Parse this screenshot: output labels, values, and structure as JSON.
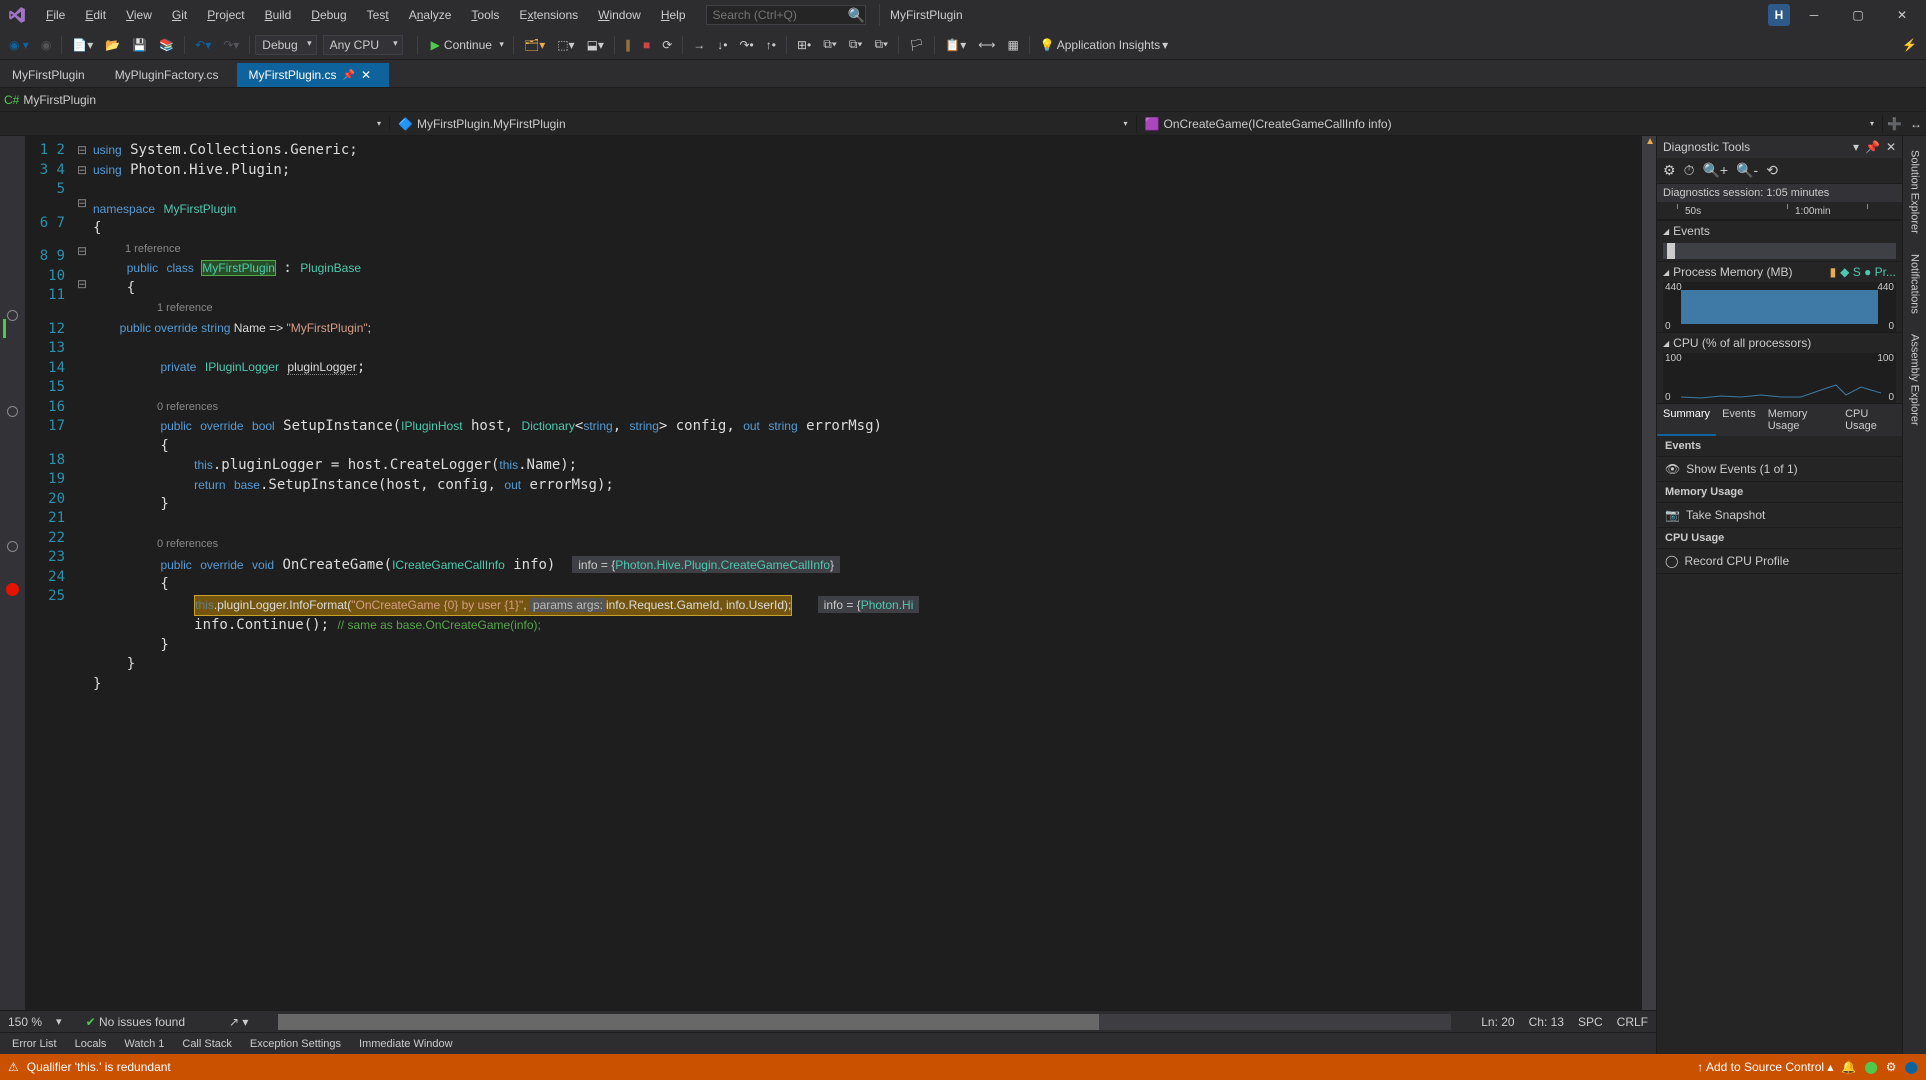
{
  "menubar": {
    "items": [
      "File",
      "Edit",
      "View",
      "Git",
      "Project",
      "Build",
      "Debug",
      "Test",
      "Analyze",
      "Tools",
      "Extensions",
      "Window",
      "Help"
    ],
    "search_placeholder": "Search (Ctrl+Q)",
    "app_title": "MyFirstPlugin",
    "user_initial": "H"
  },
  "toolbar": {
    "config": "Debug",
    "platform": "Any CPU",
    "continue": "Continue",
    "insights": "Application Insights"
  },
  "tabs": [
    {
      "label": "MyFirstPlugin",
      "active": false
    },
    {
      "label": "MyPluginFactory.cs",
      "active": false
    },
    {
      "label": "MyFirstPlugin.cs",
      "active": true,
      "pinned": true
    }
  ],
  "nav": {
    "project": "MyFirstPlugin"
  },
  "context": {
    "class": "MyFirstPlugin.MyFirstPlugin",
    "member": "OnCreateGame(ICreateGameCallInfo info)"
  },
  "codelens": {
    "ref1": "1 reference",
    "ref1b": "1 reference",
    "ref0a": "0 references",
    "ref0b": "0 references"
  },
  "datatip1": {
    "prefix": "info = {",
    "type": "Photon.Hive.Plugin.CreateGameCallInfo",
    "suffix": "}"
  },
  "datatip2": {
    "prefix": "info = {",
    "type": "Photon.Hi"
  },
  "param_hint": "params args:",
  "editor_status": {
    "zoom": "150 %",
    "issues": "No issues found",
    "line": "Ln: 20",
    "col": "Ch: 13",
    "ins": "SPC",
    "eol": "CRLF"
  },
  "bottom_tabs": [
    "Error List",
    "Locals",
    "Watch 1",
    "Call Stack",
    "Exception Settings",
    "Immediate Window"
  ],
  "status": {
    "msg": "Qualifier 'this.' is redundant",
    "source": "Add to Source Control"
  },
  "diag": {
    "title": "Diagnostic Tools",
    "session": "Diagnostics session: 1:05 minutes",
    "timeline": {
      "t1": "50s",
      "t2": "1:00min"
    },
    "events": "Events",
    "mem": {
      "title": "Process Memory (MB)",
      "max": "440",
      "min": "0",
      "legend": "◆ S  ● Pr..."
    },
    "cpu": {
      "title": "CPU (% of all processors)",
      "max": "100",
      "min": "0"
    },
    "tabs": [
      "Summary",
      "Events",
      "Memory Usage",
      "CPU Usage"
    ],
    "sections": {
      "events": {
        "title": "Events",
        "action": "Show Events (1 of 1)"
      },
      "memory": {
        "title": "Memory Usage",
        "action": "Take Snapshot"
      },
      "cpu": {
        "title": "CPU Usage",
        "action": "Record CPU Profile"
      }
    }
  },
  "side_tabs": [
    "Solution Explorer",
    "Notifications",
    "Assembly Explorer"
  ],
  "chart_data": {
    "type": "line",
    "charts": [
      {
        "name": "Process Memory",
        "unit": "MB",
        "ylim": [
          0,
          440
        ],
        "x_range_seconds": [
          45,
          70
        ],
        "series": [
          {
            "name": "Process Memory",
            "sampled_values": [
              420,
              420,
              420,
              420,
              420,
              420,
              420,
              420,
              420,
              420
            ]
          }
        ],
        "note": "approx constant ~420MB"
      },
      {
        "name": "CPU",
        "unit": "% of all processors",
        "ylim": [
          0,
          100
        ],
        "x_range_seconds": [
          45,
          70
        ],
        "series": [
          {
            "name": "CPU",
            "sampled_values": [
              2,
              1,
              3,
              2,
              4,
              2,
              15,
              20,
              5,
              18
            ]
          }
        ],
        "note": "mostly low with small spikes near end"
      }
    ]
  }
}
